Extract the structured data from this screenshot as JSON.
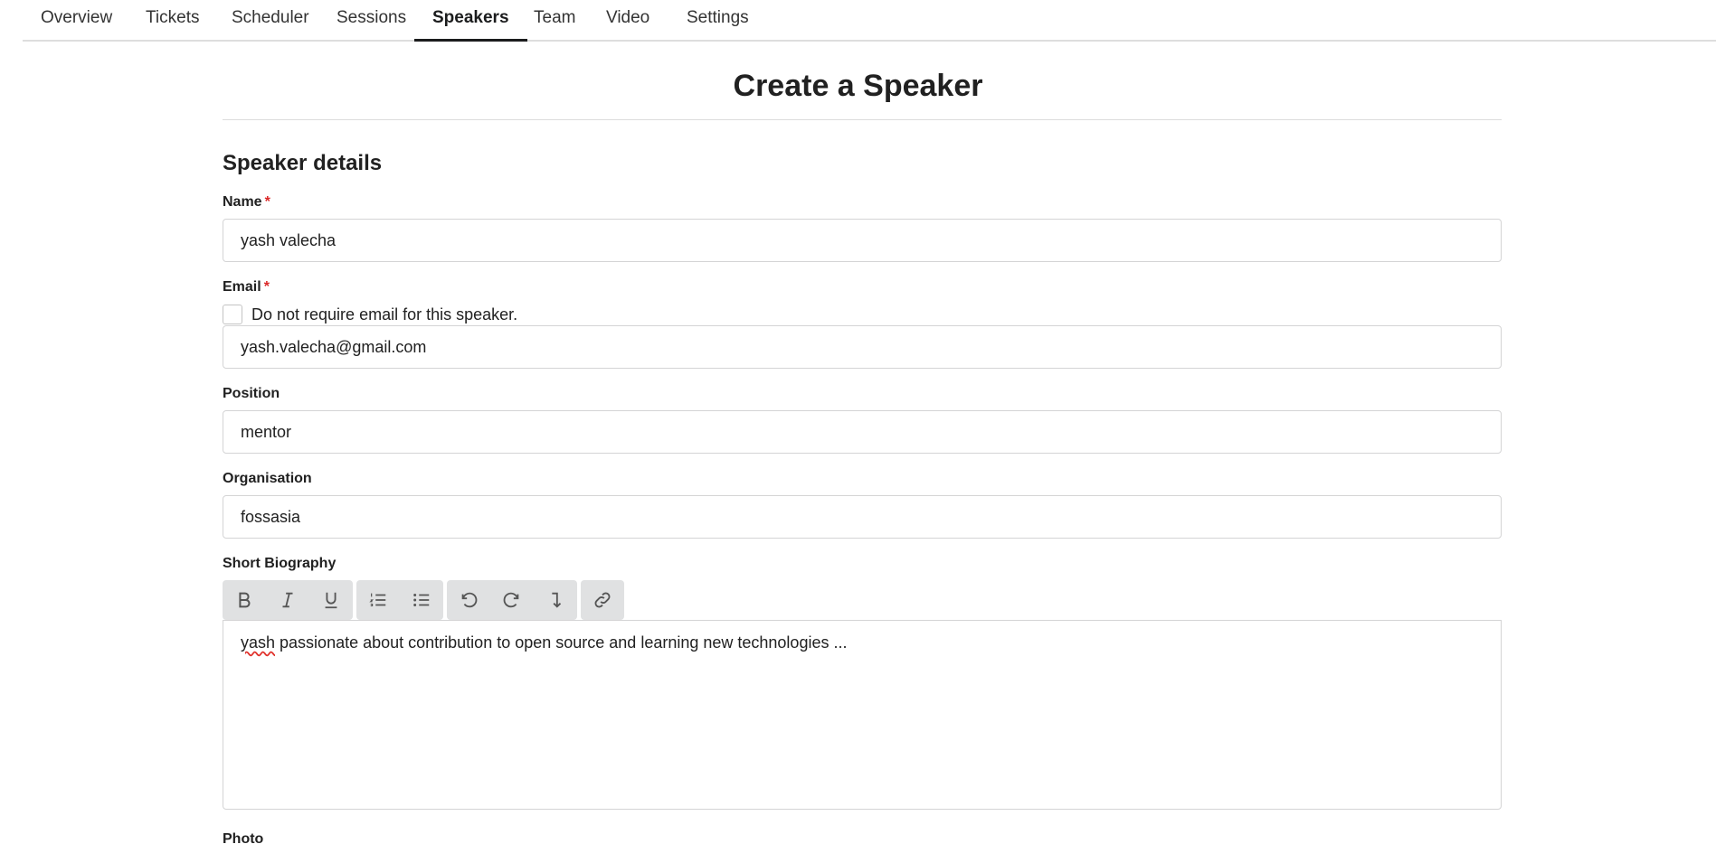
{
  "nav": {
    "items": [
      {
        "label": "Overview"
      },
      {
        "label": "Tickets"
      },
      {
        "label": "Scheduler"
      },
      {
        "label": "Sessions"
      },
      {
        "label": "Speakers",
        "active": true
      },
      {
        "label": "Team"
      },
      {
        "label": "Video"
      },
      {
        "label": "Settings"
      }
    ]
  },
  "page": {
    "title": "Create a Speaker",
    "section_title": "Speaker details"
  },
  "form": {
    "name": {
      "label": "Name",
      "required_mark": "*",
      "value": "yash valecha"
    },
    "email": {
      "label": "Email",
      "required_mark": "*",
      "checkbox_label": "Do not require email for this speaker.",
      "checkbox_checked": false,
      "value": "yash.valecha@gmail.com"
    },
    "position": {
      "label": "Position",
      "value": "mentor"
    },
    "organisation": {
      "label": "Organisation",
      "value": "fossasia"
    },
    "bio": {
      "label": "Short Biography",
      "first_word": "yash",
      "rest": " passionate about contribution to open source and learning new technologies ...",
      "toolbar": [
        [
          "bold-icon",
          "italic-icon",
          "underline-icon"
        ],
        [
          "ordered-list-icon",
          "unordered-list-icon"
        ],
        [
          "undo-icon",
          "redo-icon",
          "remove-format-icon"
        ],
        [
          "link-icon"
        ]
      ]
    },
    "photo": {
      "label": "Photo"
    }
  },
  "colors": {
    "required": "#db2828",
    "toolbar_bg": "#e0e1e2",
    "border": "#d4d4d5",
    "active_tab": "#1b1c1d"
  }
}
